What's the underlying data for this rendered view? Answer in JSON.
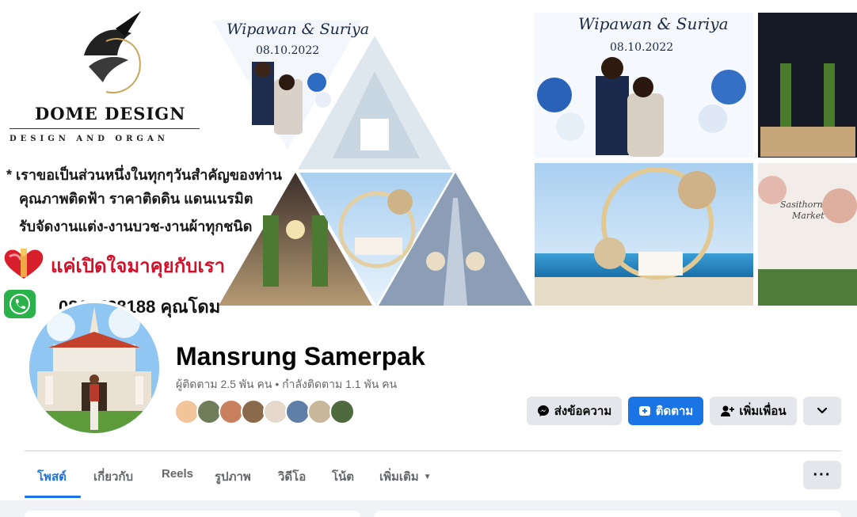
{
  "cover": {
    "brand_name": "DOME DESIGN",
    "brand_tagline": "DESIGN AND ORGAN",
    "slogan_lines": [
      "* เราขอเป็นส่วนหนึ่งในทุกๆวันสำคัญของท่าน",
      "คุณภาพติดฟ้า ราคาติดดิน แดนเนรมิต",
      "รับจัดงานแต่ง-งานบวช-งานผ้าทุกชนิด"
    ],
    "love_line": "แค่เปิดใจมาคุยกับเรา",
    "phone_line": "0816528188 คุณโดม",
    "couple_names": "Wipawan & Suriya",
    "event_date": "08.10.2022",
    "backdrop_script": "Sasithorn\nMarket"
  },
  "profile": {
    "name": "Mansrung Samerpak",
    "stats": "ผู้ติดตาม 2.5 พัน คน • กำลังติดตาม 1.1 พัน คน",
    "follower_avatar_count": 8
  },
  "actions": {
    "message_label": "ส่งข้อความ",
    "follow_label": "ติดตาม",
    "add_friend_label": "เพิ่มเพื่อน",
    "more_icon": "chevron-down-icon"
  },
  "tabs": {
    "posts": "โพสต์",
    "about": "เกี่ยวกับ",
    "reels": "Reels",
    "photos": "รูปภาพ",
    "videos": "วิดีโอ",
    "notes": "โน้ต",
    "more": "เพิ่มเติม",
    "overflow_icon": "more-dots-icon"
  },
  "colors": {
    "accent": "#1b74e4",
    "secondary_button": "#e4e6eb",
    "muted_text": "#65676b",
    "love_red": "#d4102a",
    "phone_green": "#29b24a"
  }
}
